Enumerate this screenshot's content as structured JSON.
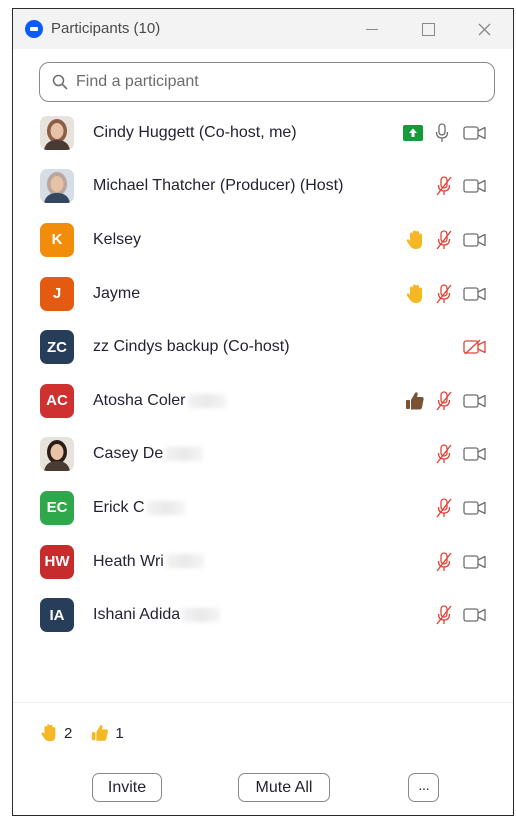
{
  "window": {
    "title": "Participants (10)"
  },
  "search": {
    "placeholder": "Find a participant"
  },
  "participants": [
    {
      "name": "Cindy Huggett (Co-host, me)",
      "avatar": "photo",
      "avatar_color": "#c9a894",
      "sharing": true,
      "mic": "unmuted",
      "video": "off",
      "reaction": ""
    },
    {
      "name": "Michael Thatcher (Producer) (Host)",
      "avatar": "photo",
      "avatar_color": "#b58e7a",
      "sharing": false,
      "mic": "muted",
      "video": "off",
      "reaction": ""
    },
    {
      "name": "Kelsey",
      "avatar": "K",
      "avatar_color": "#f28c0b",
      "sharing": false,
      "mic": "muted",
      "video": "off",
      "reaction": "raised-hand"
    },
    {
      "name": "Jayme",
      "avatar": "J",
      "avatar_color": "#e35a10",
      "sharing": false,
      "mic": "muted",
      "video": "off",
      "reaction": "raised-hand"
    },
    {
      "name": "zz Cindys backup (Co-host)",
      "avatar": "ZC",
      "avatar_color": "#273e5a",
      "sharing": false,
      "mic": "none",
      "video": "muted",
      "reaction": ""
    },
    {
      "name": "Atosha Coler",
      "avatar": "AC",
      "avatar_color": "#cf3131",
      "sharing": false,
      "mic": "muted",
      "video": "off",
      "reaction": "thumbs-up",
      "redacted": true
    },
    {
      "name": "Casey De",
      "avatar": "photo",
      "avatar_color": "#3b2a25",
      "sharing": false,
      "mic": "muted",
      "video": "off",
      "reaction": "",
      "redacted": true
    },
    {
      "name": "Erick C",
      "avatar": "EC",
      "avatar_color": "#2ea84a",
      "sharing": false,
      "mic": "muted",
      "video": "off",
      "reaction": "",
      "redacted": true
    },
    {
      "name": "Heath Wri",
      "avatar": "HW",
      "avatar_color": "#c62c2c",
      "sharing": false,
      "mic": "muted",
      "video": "off",
      "reaction": "",
      "redacted": true
    },
    {
      "name": "Ishani Adida",
      "avatar": "IA",
      "avatar_color": "#273e5a",
      "sharing": false,
      "mic": "muted",
      "video": "off",
      "reaction": "",
      "redacted": true
    }
  ],
  "reaction_summary": [
    {
      "icon": "raised-hand-icon",
      "count": "2"
    },
    {
      "icon": "thumbs-up-icon",
      "count": "1"
    }
  ],
  "footer": {
    "invite_label": "Invite",
    "mute_all_label": "Mute All",
    "more_label": "···"
  },
  "colors": {
    "muted_red": "#e0453a",
    "share_green": "#159c39",
    "hand_yellow": "#f5b825",
    "thumbs_brown": "#7a5236",
    "icon_gray": "#6e6e6e"
  }
}
